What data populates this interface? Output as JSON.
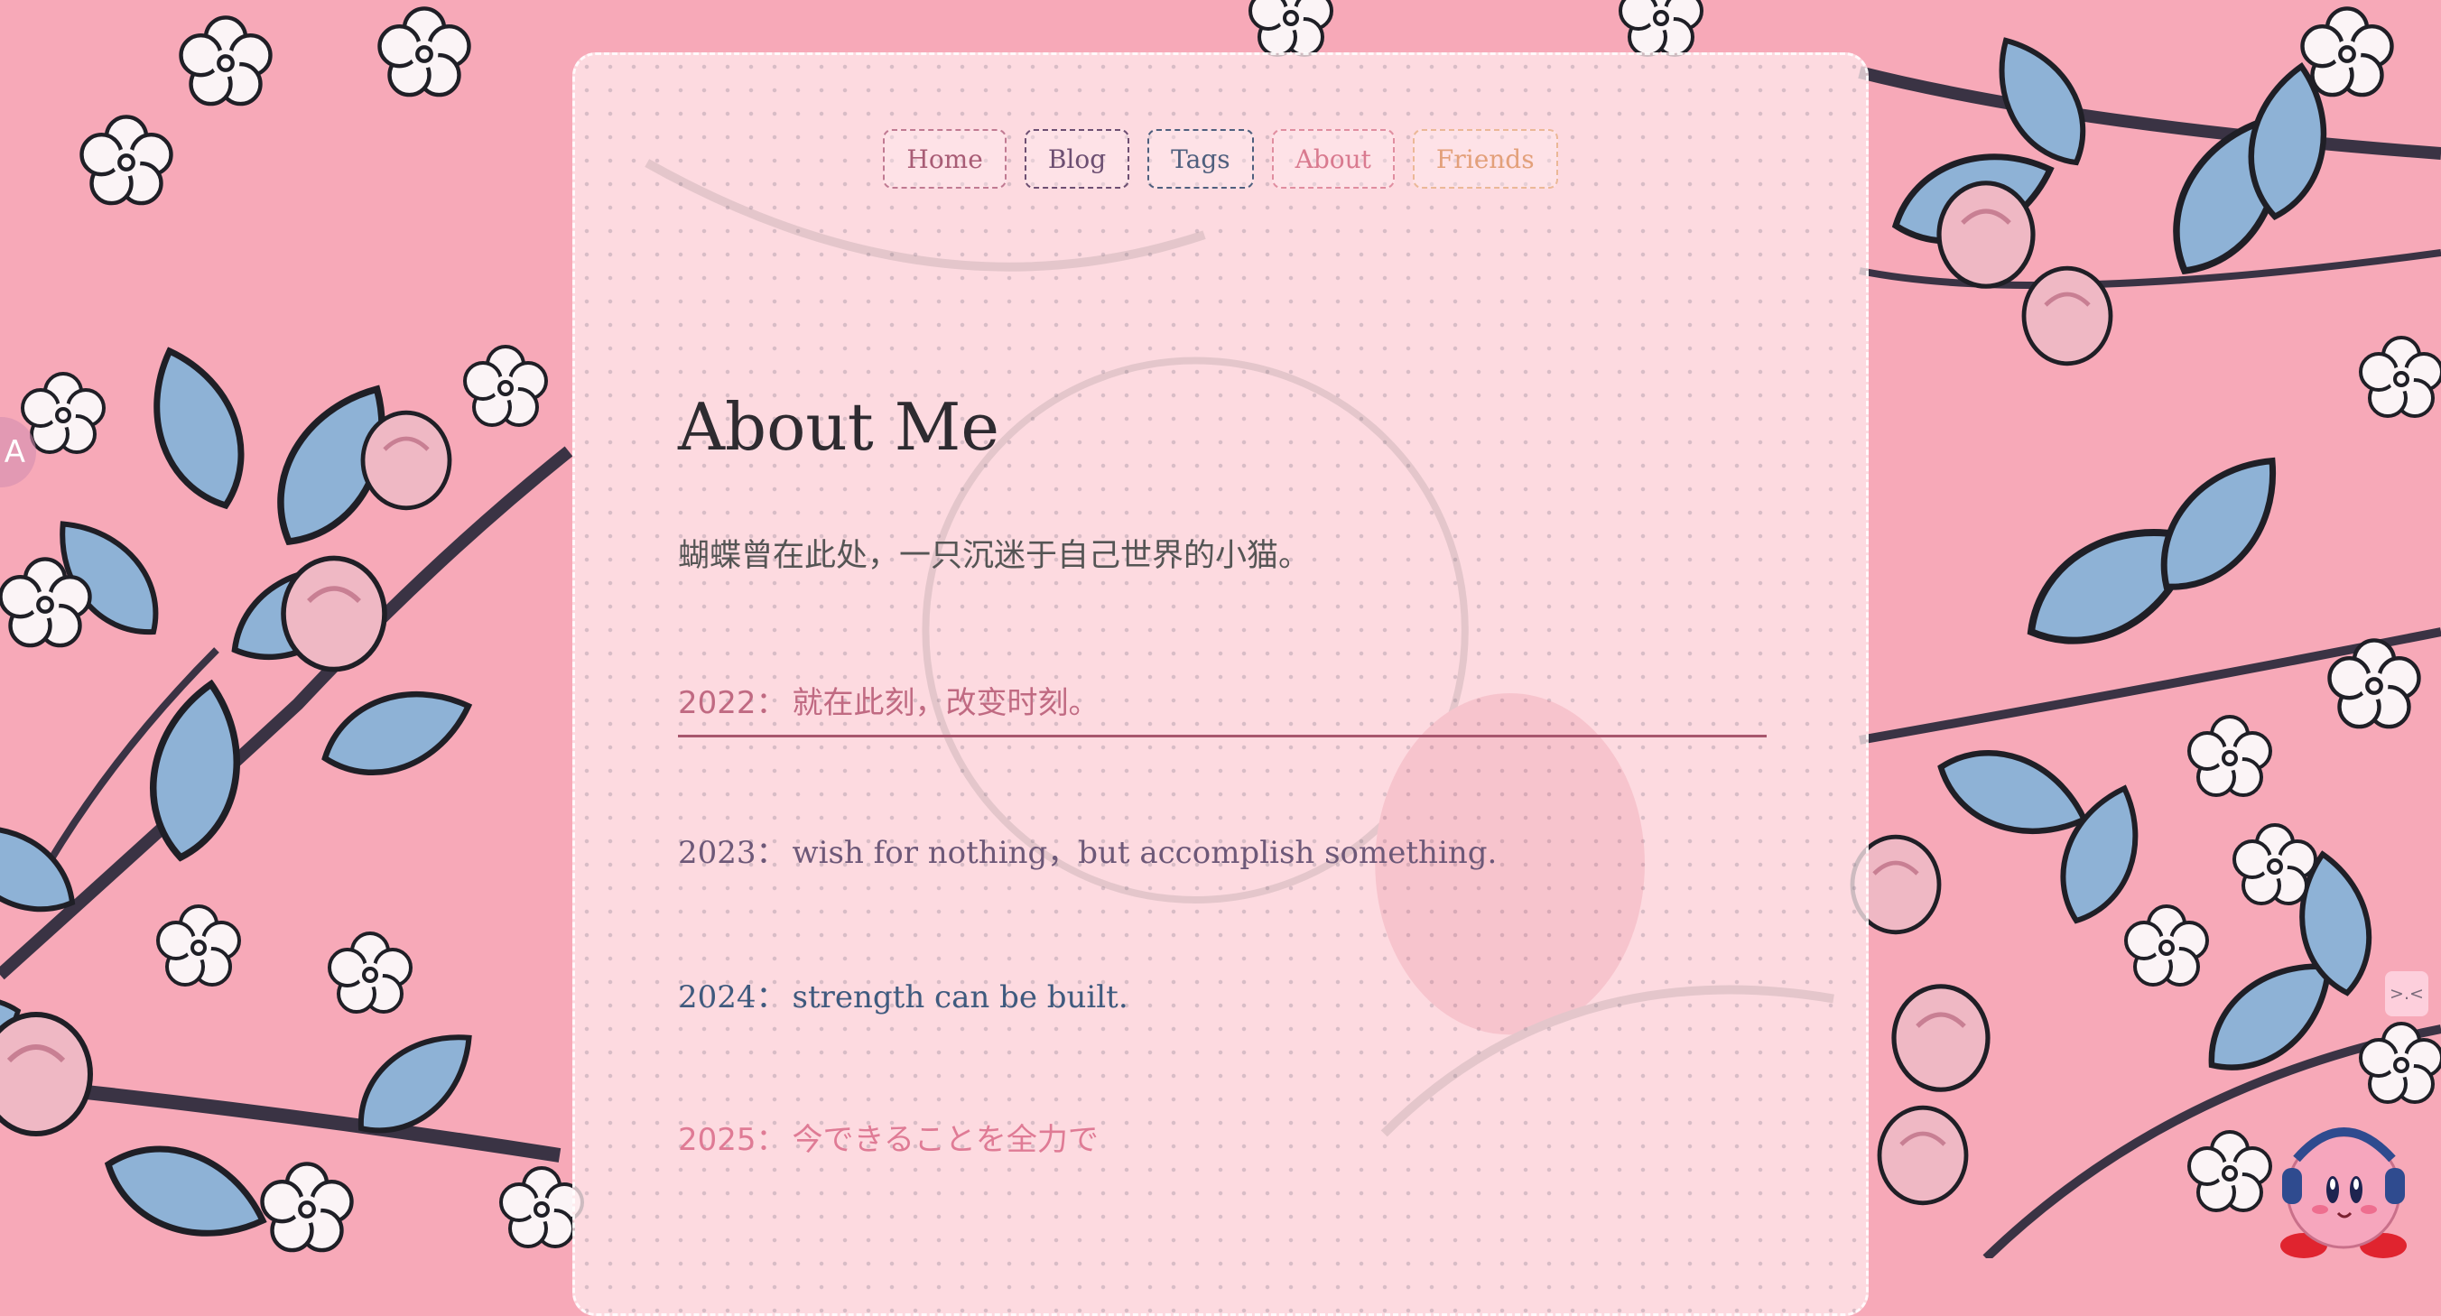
{
  "nav": {
    "home": "Home",
    "blog": "Blog",
    "tags": "Tags",
    "about": "About",
    "friends": "Friends"
  },
  "page": {
    "title": "About Me",
    "intro": "蝴蝶曾在此处，一只沉迷于自己世界的小猫。"
  },
  "timeline": [
    {
      "year": "2022：",
      "text": "就在此刻，改变时刻。"
    },
    {
      "year": "2023：",
      "text": "wish for nothing，but accomplish something."
    },
    {
      "year": "2024：",
      "text": "strength can be built."
    },
    {
      "year": "2025：",
      "text": "今できることを全力で"
    }
  ],
  "widgets": {
    "side_letter": "A",
    "kaomoji": ">.<"
  },
  "colors": {
    "background": "#f7a9b8",
    "leaf": "#8eb2d6",
    "accent_line": "#a7566d"
  },
  "icons": [
    "flower-icon",
    "leaf-icon",
    "kirby-mascot-icon"
  ]
}
